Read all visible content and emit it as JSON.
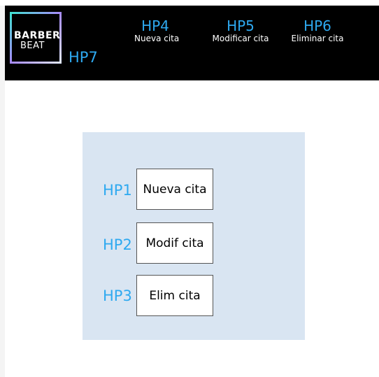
{
  "logo": {
    "line1": "BARBER",
    "line2": "BEAT"
  },
  "nav": {
    "home_hotspot": "HP7",
    "items": [
      {
        "hotspot": "HP4",
        "label": "Nueva cita"
      },
      {
        "hotspot": "HP5",
        "label": "Modificar cita"
      },
      {
        "hotspot": "HP6",
        "label": "Eliminar cita"
      }
    ]
  },
  "actions": [
    {
      "hotspot": "HP1",
      "label": "Nueva cita"
    },
    {
      "hotspot": "HP2",
      "label": "Modif cita"
    },
    {
      "hotspot": "HP3",
      "label": "Elim cita"
    }
  ],
  "colors": {
    "navbar_bg": "#000000",
    "hotspot_label": "#2ea9f0",
    "panel_bg": "#d9e5f2",
    "logo_border_gradient": [
      "#3fe0d0",
      "#a78bfa",
      "#e0e7ff"
    ]
  }
}
